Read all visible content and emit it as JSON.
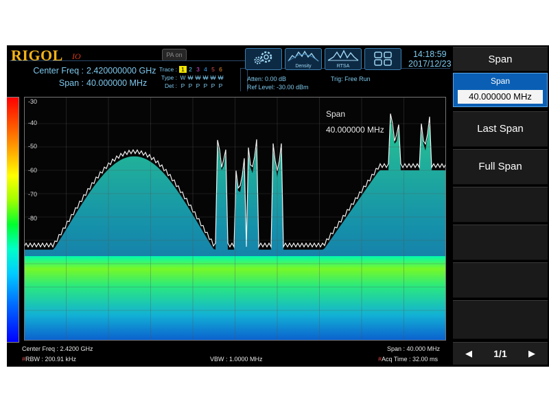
{
  "brand": {
    "name": "RIGOL",
    "model": "ΙΟ"
  },
  "header": {
    "pa_badge": "PA on",
    "center_freq_label": "Center Freq :",
    "center_freq_value": "2.420000000 GHz",
    "span_label": "Span :",
    "span_value": "40.000000 MHz",
    "trace_label": "Trace :",
    "trace_numbers": [
      "1",
      "2",
      "3",
      "4",
      "5",
      "6"
    ],
    "type_label": "Type :",
    "type_values": [
      "W",
      "W",
      "W",
      "W",
      "W",
      "W"
    ],
    "det_label": "Det :",
    "det_values": [
      "P",
      "P",
      "P",
      "P",
      "P",
      "P"
    ],
    "atten": "Atten: 0.00 dB",
    "ref_level": "Ref Level: -30.00 dBm",
    "trig": "Trig: Free Run",
    "tools": [
      {
        "icon": "settings-gears-icon",
        "label": ""
      },
      {
        "icon": "density-icon",
        "label": "Density"
      },
      {
        "icon": "rtsa-icon",
        "label": "RTSA"
      },
      {
        "icon": "layout-grid-icon",
        "label": ""
      }
    ],
    "time": "14:18:59",
    "date": "2017/12/23"
  },
  "plot": {
    "y_ticks": [
      "-30",
      "-40",
      "-50",
      "-60",
      "-70",
      "-80"
    ],
    "annotation_label": "Span",
    "annotation_value": "40.000000 MHz",
    "colors": {
      "trace": "#ffffff",
      "density_high": "#00ff30",
      "density_low": "#00ccff"
    }
  },
  "footer": {
    "center_freq": "Center Freq : 2.4200 GHz",
    "rbw_hash": "#",
    "rbw": "RBW : 200.91 kHz",
    "vbw": "VBW : 1.0000 MHz",
    "span": "Span : 40.000 MHz",
    "acq_hash": "#",
    "acq_time": "Acq Time : 32.00 ms"
  },
  "menu": {
    "title": "Span",
    "span_label": "Span",
    "span_value": "40.000000 MHz",
    "last_span": "Last Span",
    "full_span": "Full Span",
    "page": "1/1",
    "prev": "◀",
    "next": "▶"
  }
}
